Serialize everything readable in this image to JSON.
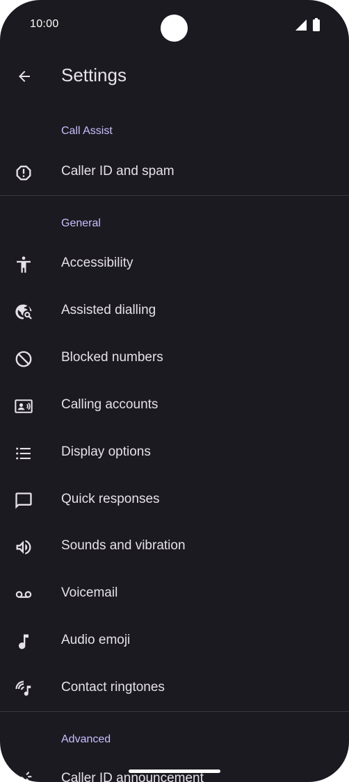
{
  "status_bar": {
    "time": "10:00",
    "icons": [
      "signal-icon",
      "battery-icon"
    ]
  },
  "app_bar": {
    "back_icon": "arrow-back-icon",
    "title": "Settings"
  },
  "sections": {
    "call_assist": {
      "header": "Call Assist",
      "items": [
        {
          "label": "Caller ID and spam",
          "icon": "spam-alert-icon"
        }
      ]
    },
    "general": {
      "header": "General",
      "items": [
        {
          "label": "Accessibility",
          "icon": "accessibility-icon"
        },
        {
          "label": "Assisted dialling",
          "icon": "globe-search-icon"
        },
        {
          "label": "Blocked numbers",
          "icon": "block-icon"
        },
        {
          "label": "Calling accounts",
          "icon": "contact-card-icon"
        },
        {
          "label": "Display options",
          "icon": "list-icon"
        },
        {
          "label": "Quick responses",
          "icon": "chat-bubble-icon"
        },
        {
          "label": "Sounds and vibration",
          "icon": "volume-icon"
        },
        {
          "label": "Voicemail",
          "icon": "voicemail-icon"
        },
        {
          "label": "Audio emoji",
          "icon": "music-note-icon"
        },
        {
          "label": "Contact ringtones",
          "icon": "ringtone-icon"
        }
      ]
    },
    "advanced": {
      "header": "Advanced",
      "items": [
        {
          "label": "Caller ID announcement",
          "icon": "announcement-icon"
        }
      ]
    }
  },
  "colors": {
    "background": "#1b1a20",
    "text": "#e6e1e8",
    "section_header": "#c8bfff",
    "divider": "#3b3940"
  }
}
